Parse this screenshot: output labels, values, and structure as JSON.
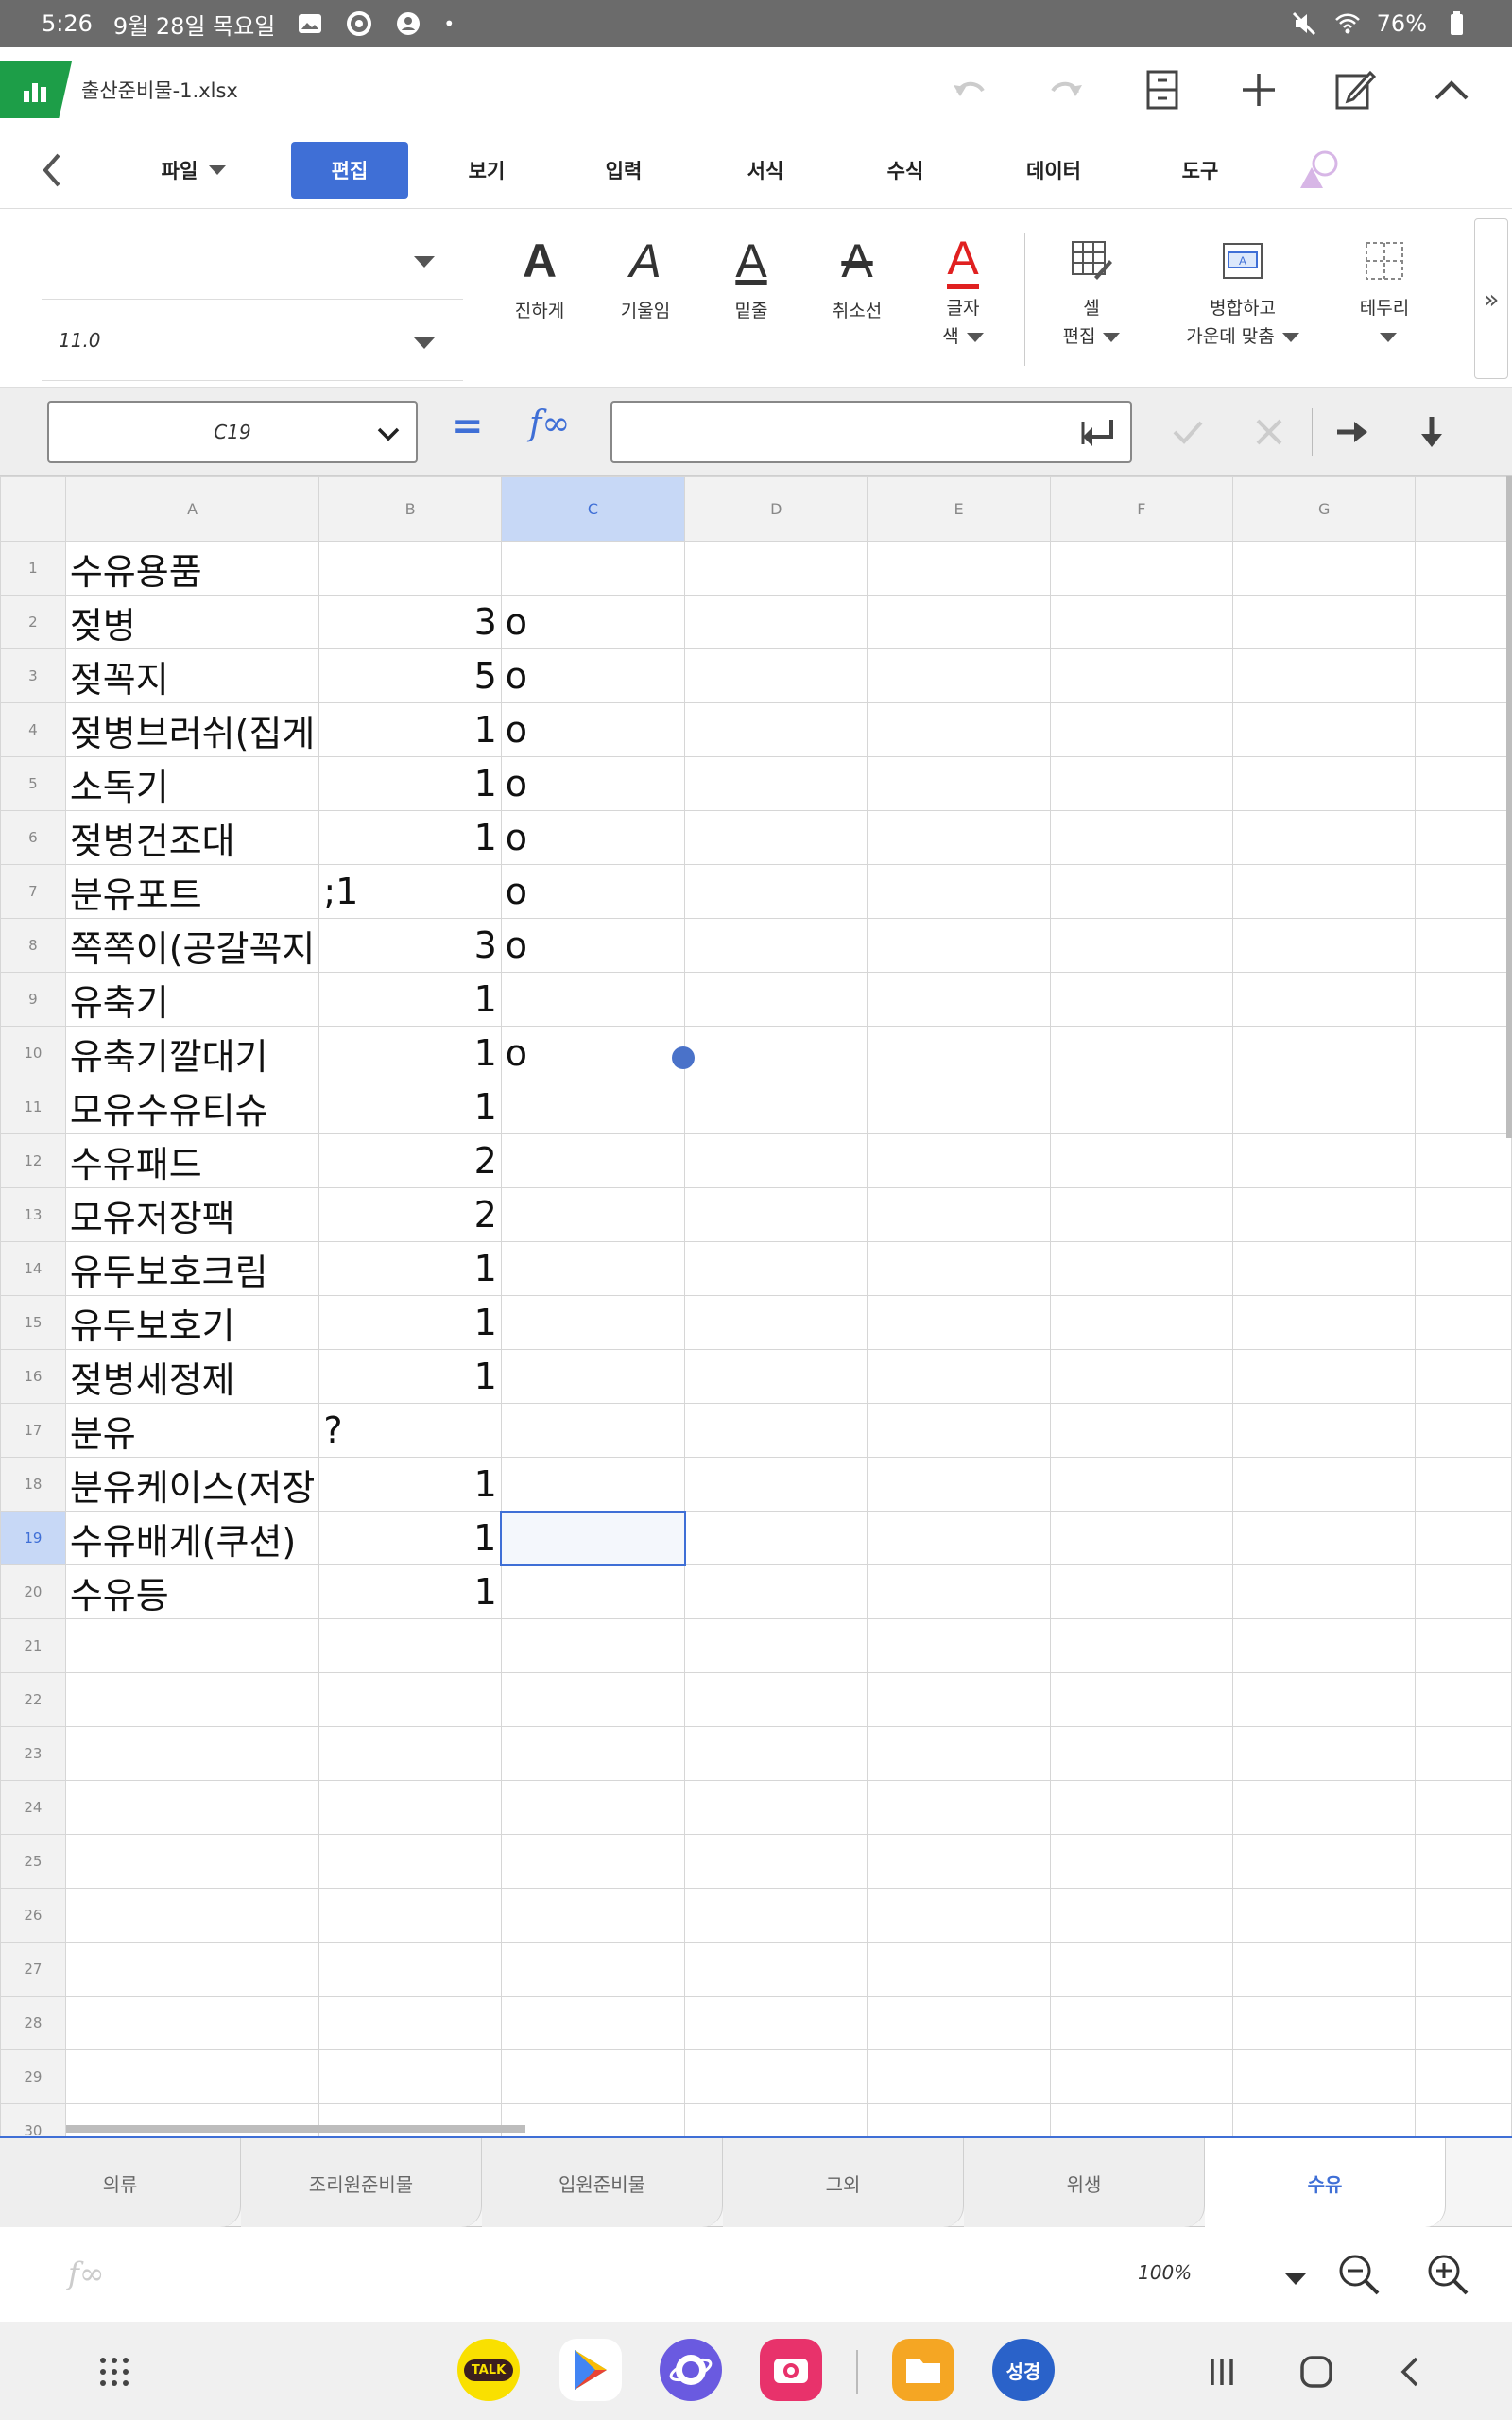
{
  "status_bar": {
    "time": "5:26",
    "date": "9월 28일 목요일",
    "battery": "76%"
  },
  "title_bar": {
    "file_name": "출산준비물-1.xlsx",
    "icons": [
      "undo-icon",
      "redo-icon",
      "view-icon",
      "add-icon",
      "edit-icon",
      "collapse-icon"
    ]
  },
  "menu": {
    "tabs": [
      {
        "label": "파일",
        "dropdown": true
      },
      {
        "label": "편집",
        "active": true
      },
      {
        "label": "보기"
      },
      {
        "label": "입력"
      },
      {
        "label": "서식"
      },
      {
        "label": "수식"
      },
      {
        "label": "데이터"
      },
      {
        "label": "도구"
      }
    ]
  },
  "ribbon": {
    "font_name": "",
    "font_size": "11.0",
    "bold_label": "진하게",
    "italic_label": "기울임",
    "underline_label": "밑줄",
    "strike_label": "취소선",
    "font_color_label_1": "글자",
    "font_color_label_2": "색",
    "cell_edit_label_1": "셀",
    "cell_edit_label_2": "편집",
    "merge_label_1": "병합하고",
    "merge_label_2": "가운데 맞춤",
    "border_label": "테두리",
    "more": "»",
    "font_color": "#e02020"
  },
  "formula_bar": {
    "cell_ref": "C19",
    "formula": ""
  },
  "sheet": {
    "columns": [
      "A",
      "B",
      "C",
      "D",
      "E",
      "F",
      "G"
    ],
    "selected_column": "C",
    "selected_row": 19,
    "rows": [
      {
        "n": "1",
        "a": "수유용품",
        "b": "",
        "c": ""
      },
      {
        "n": "2",
        "a": "젖병",
        "b": "3",
        "c": "o"
      },
      {
        "n": "3",
        "a": "젖꼭지",
        "b": "5",
        "c": "o"
      },
      {
        "n": "4",
        "a": "젖병브러쉬(집게",
        "b": "1",
        "c": "o"
      },
      {
        "n": "5",
        "a": "소독기",
        "b": "1",
        "c": "o"
      },
      {
        "n": "6",
        "a": "젖병건조대",
        "b": "1",
        "c": "o"
      },
      {
        "n": "7",
        "a": "분유포트",
        "b": ";1",
        "c": "o",
        "b_left": true
      },
      {
        "n": "8",
        "a": "쪽쪽이(공갈꼭지",
        "b": "3",
        "c": "o"
      },
      {
        "n": "9",
        "a": "유축기",
        "b": "1",
        "c": ""
      },
      {
        "n": "10",
        "a": "유축기깔대기",
        "b": "1",
        "c": "o"
      },
      {
        "n": "11",
        "a": "모유수유티슈",
        "b": "1",
        "c": ""
      },
      {
        "n": "12",
        "a": "수유패드",
        "b": "2",
        "c": ""
      },
      {
        "n": "13",
        "a": "모유저장팩",
        "b": "2",
        "c": ""
      },
      {
        "n": "14",
        "a": "유두보호크림",
        "b": "1",
        "c": ""
      },
      {
        "n": "15",
        "a": "유두보호기",
        "b": "1",
        "c": ""
      },
      {
        "n": "16",
        "a": "젖병세정제",
        "b": "1",
        "c": ""
      },
      {
        "n": "17",
        "a": "분유",
        "b": "?",
        "c": "",
        "b_left": true
      },
      {
        "n": "18",
        "a": "분유케이스(저장",
        "b": "1",
        "c": ""
      },
      {
        "n": "19",
        "a": "수유배게(쿠션)",
        "b": "1",
        "c": ""
      },
      {
        "n": "20",
        "a": "수유등",
        "b": "1",
        "c": ""
      },
      {
        "n": "21",
        "a": "",
        "b": "",
        "c": ""
      },
      {
        "n": "22",
        "a": "",
        "b": "",
        "c": ""
      },
      {
        "n": "23",
        "a": "",
        "b": "",
        "c": ""
      },
      {
        "n": "24",
        "a": "",
        "b": "",
        "c": ""
      },
      {
        "n": "25",
        "a": "",
        "b": "",
        "c": ""
      },
      {
        "n": "26",
        "a": "",
        "b": "",
        "c": ""
      },
      {
        "n": "27",
        "a": "",
        "b": "",
        "c": ""
      },
      {
        "n": "28",
        "a": "",
        "b": "",
        "c": ""
      },
      {
        "n": "29",
        "a": "",
        "b": "",
        "c": ""
      },
      {
        "n": "30",
        "a": "",
        "b": "",
        "c": ""
      }
    ]
  },
  "sheet_tabs": [
    {
      "label": "의류"
    },
    {
      "label": "조리원준비물"
    },
    {
      "label": "입원준비물"
    },
    {
      "label": "그외"
    },
    {
      "label": "위생"
    },
    {
      "label": "수유",
      "active": true
    }
  ],
  "bottom_bar": {
    "zoom": "100%"
  },
  "dock": {
    "apps": [
      {
        "name": "kakaotalk",
        "label": "TALK",
        "color": "#f9e000"
      },
      {
        "name": "play-store",
        "label": "",
        "color": "#ffffff"
      },
      {
        "name": "samsung-internet",
        "label": "",
        "color": "#6a5ae0"
      },
      {
        "name": "camera",
        "label": "",
        "color": "#e8326b"
      },
      {
        "name": "my-files",
        "label": "",
        "color": "#f5a623"
      },
      {
        "name": "bible",
        "label": "성경",
        "color": "#2a62c9"
      }
    ]
  }
}
